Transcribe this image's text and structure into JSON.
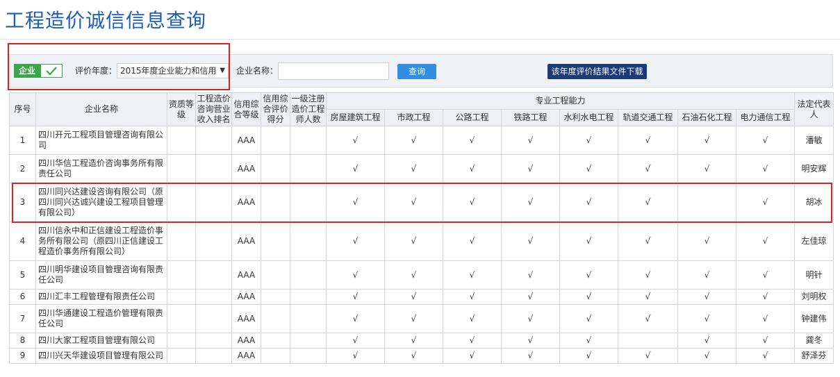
{
  "page": {
    "title": "工程造价诚信信息查询"
  },
  "toolbar": {
    "toggle_label": "企业",
    "year_label": "评价年度：",
    "year_value": "2015年度企业能力和信用",
    "name_label": "企业名称：",
    "name_value": "",
    "query_button": "查询",
    "download_button": "该年度评价结果文件下载"
  },
  "table": {
    "headers": {
      "index": "序号",
      "company": "企业名称",
      "qualification": "资质等级",
      "revenue_rank": "工程造价咨询营业收入排名",
      "credit_level": "信用综合等级",
      "credit_score": "信用综合评价得分",
      "engineers": "一级注册造价工程师人数",
      "capability_group": "专业工程能力",
      "rep": "法定代表人",
      "capabilities": [
        "房屋建筑工程",
        "市政工程",
        "公路工程",
        "铁路工程",
        "水利水电工程",
        "轨道交通工程",
        "石油石化工程",
        "电力通信工程"
      ]
    },
    "rows": [
      {
        "index": "1",
        "company": "四川开元工程项目管理咨询有限公司",
        "qualification": "",
        "revenue_rank": "",
        "credit_level": "AAA",
        "credit_score": "",
        "engineers": "",
        "checks": [
          "√",
          "√",
          "√",
          "√",
          "√",
          "√",
          "√",
          "√"
        ],
        "rep": "潘敏"
      },
      {
        "index": "2",
        "company": "四川华信工程造价咨询事务所有限责任公司",
        "qualification": "",
        "revenue_rank": "",
        "credit_level": "AAA",
        "credit_score": "",
        "engineers": "",
        "checks": [
          "√",
          "√",
          "√",
          "√",
          "√",
          "√",
          "√",
          "√"
        ],
        "rep": "明安辉"
      },
      {
        "index": "3",
        "company": "四川同兴达建设咨询有限公司（原四川同兴达诚兴建设工程项目管理有限公司）",
        "qualification": "",
        "revenue_rank": "",
        "credit_level": "AAA",
        "credit_score": "",
        "engineers": "",
        "checks": [
          "√",
          "√",
          "√",
          "√",
          "√",
          "√",
          "",
          "√"
        ],
        "rep": "胡冰"
      },
      {
        "index": "4",
        "company": "四川信永中和正信建设工程造价事务所有限公司（原四川正信建设工程造价事务所有限公司）",
        "qualification": "",
        "revenue_rank": "",
        "credit_level": "AAA",
        "credit_score": "",
        "engineers": "",
        "checks": [
          "√",
          "√",
          "√",
          "√",
          "√",
          "√",
          "√",
          "√"
        ],
        "rep": "左佳琼"
      },
      {
        "index": "5",
        "company": "四川明华建设项目管理咨询有限责任公司",
        "qualification": "",
        "revenue_rank": "",
        "credit_level": "AAA",
        "credit_score": "",
        "engineers": "",
        "checks": [
          "√",
          "√",
          "√",
          "√",
          "√",
          "√",
          "√",
          "√"
        ],
        "rep": "明针"
      },
      {
        "index": "6",
        "company": "四川汇丰工程管理有限责任公司",
        "qualification": "",
        "revenue_rank": "",
        "credit_level": "AAA",
        "credit_score": "",
        "engineers": "",
        "checks": [
          "√",
          "√",
          "√",
          "√",
          "√",
          "√",
          "√",
          "√"
        ],
        "rep": "刘明权"
      },
      {
        "index": "7",
        "company": "四川华通建设工程造价管理有限责任公司",
        "qualification": "",
        "revenue_rank": "",
        "credit_level": "AAA",
        "credit_score": "",
        "engineers": "",
        "checks": [
          "√",
          "√",
          "√",
          "√",
          "√",
          "√",
          "√",
          "√"
        ],
        "rep": "钟建伟"
      },
      {
        "index": "8",
        "company": "四川大家工程项目管理有限公司",
        "qualification": "",
        "revenue_rank": "",
        "credit_level": "AAA",
        "credit_score": "",
        "engineers": "",
        "checks": [
          "√",
          "√",
          "√",
          "√",
          "√",
          "",
          "√",
          "√"
        ],
        "rep": "龚冬"
      },
      {
        "index": "9",
        "company": "四川兴天华建设项目管理有限公司",
        "qualification": "",
        "revenue_rank": "",
        "credit_level": "AAA",
        "credit_score": "",
        "engineers": "",
        "checks": [
          "√",
          "√",
          "√",
          "√",
          "√",
          "√",
          "√",
          "√"
        ],
        "rep": "舒泽芬"
      }
    ]
  }
}
